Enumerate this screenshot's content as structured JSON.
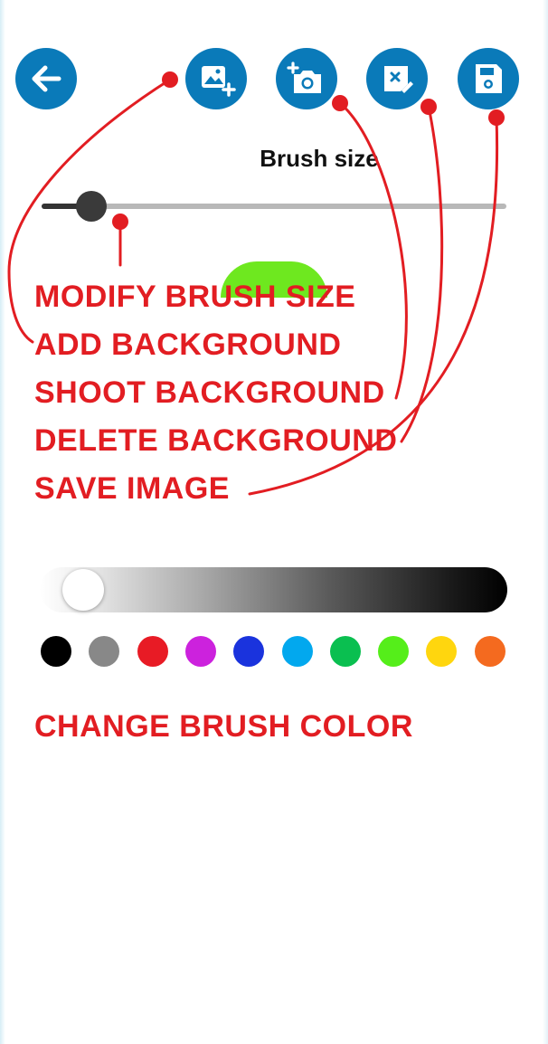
{
  "toolbar": {
    "buttons": [
      {
        "name": "back-button",
        "icon": "arrow-left-icon"
      },
      {
        "name": "add-background-button",
        "icon": "image-add-icon"
      },
      {
        "name": "shoot-background-button",
        "icon": "camera-add-icon"
      },
      {
        "name": "delete-background-button",
        "icon": "image-delete-icon"
      },
      {
        "name": "save-image-button",
        "icon": "save-icon"
      }
    ],
    "button_color": "#0a7ab9"
  },
  "brush_size": {
    "label": "Brush size",
    "value_fraction": 0.08,
    "preview_color": "#6ee81f"
  },
  "annotations": {
    "modify_brush_size": "MODIFY BRUSH SIZE",
    "add_background": "ADD BACKGROUND",
    "shoot_background": "SHOOT BACKGROUND",
    "delete_background": "DELETE BACKGROUND",
    "save_image": "SAVE IMAGE",
    "change_brush_color": "CHANGE BRUSH COLOR",
    "annotation_color": "#e21d22"
  },
  "brush_color": {
    "shade_fraction": 0.05,
    "swatches": [
      "#000000",
      "#888888",
      "#e81b25",
      "#cc22dd",
      "#1a33dd",
      "#02a8ee",
      "#0abf50",
      "#55ee1a",
      "#ffd60e",
      "#f46a1f"
    ]
  }
}
